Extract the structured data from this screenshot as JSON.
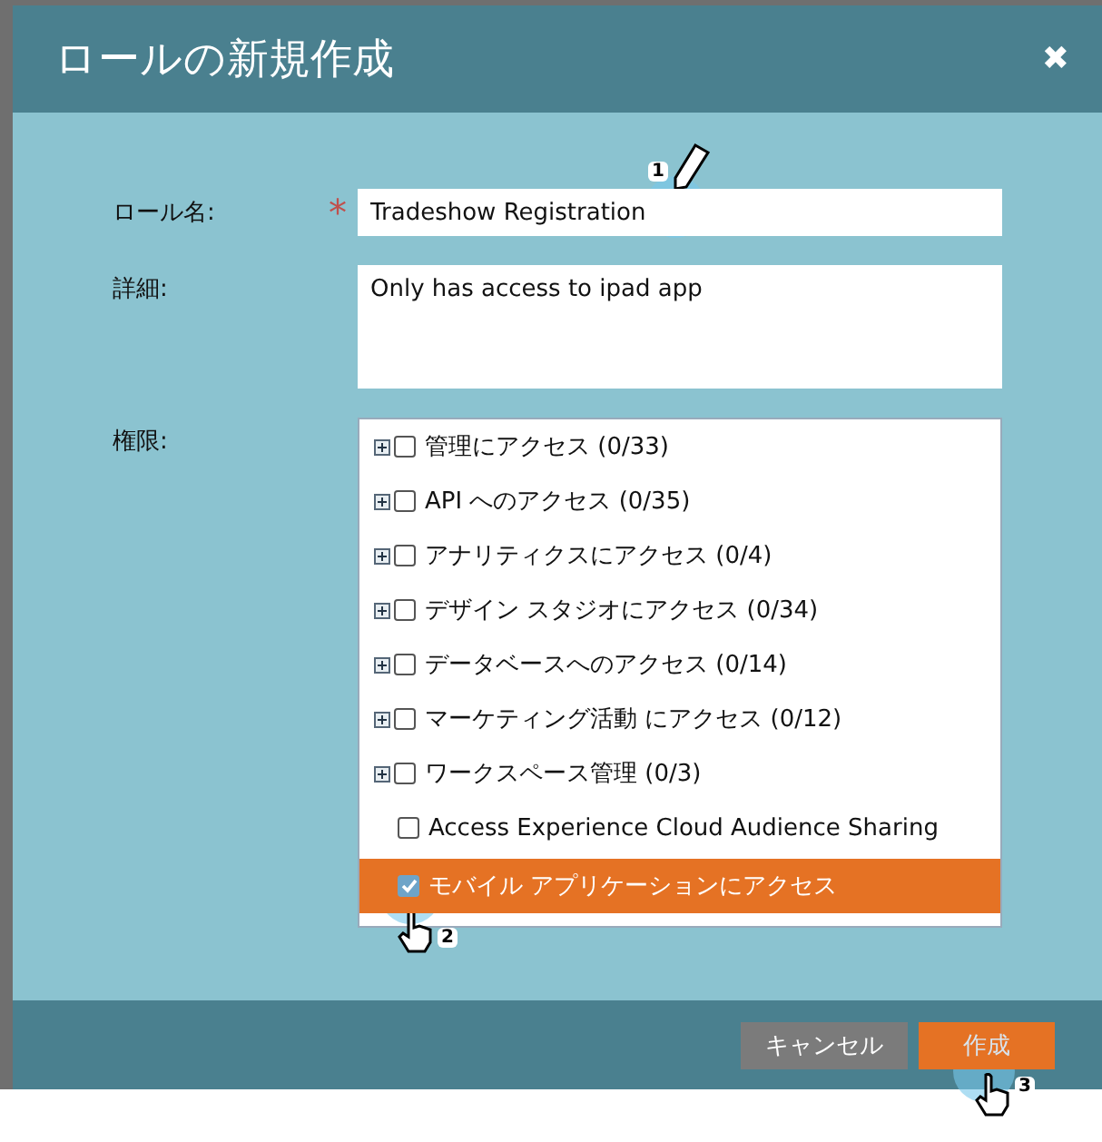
{
  "dialog": {
    "title": "ロールの新規作成",
    "close": "✖"
  },
  "form": {
    "name_label": "ロール名:",
    "required_mark": "*",
    "name_value": "Tradeshow Registration",
    "details_label": "詳細:",
    "details_value": "Only has access to ipad app",
    "permissions_label": "権限:"
  },
  "permissions": [
    {
      "kind": "group",
      "label": "管理にアクセス (0/33)",
      "checked": false,
      "selected": false
    },
    {
      "kind": "group",
      "label": "API へのアクセス (0/35)",
      "checked": false,
      "selected": false
    },
    {
      "kind": "group",
      "label": "アナリティクスにアクセス (0/4)",
      "checked": false,
      "selected": false
    },
    {
      "kind": "group",
      "label": "デザイン スタジオにアクセス (0/34)",
      "checked": false,
      "selected": false
    },
    {
      "kind": "group",
      "label": "データベースへのアクセス (0/14)",
      "checked": false,
      "selected": false
    },
    {
      "kind": "group",
      "label": "マーケティング活動 にアクセス (0/12)",
      "checked": false,
      "selected": false
    },
    {
      "kind": "group",
      "label": "ワークスペース管理 (0/3)",
      "checked": false,
      "selected": false
    },
    {
      "kind": "leaf",
      "label": "Access Experience Cloud Audience Sharing",
      "checked": false,
      "selected": false
    },
    {
      "kind": "leaf",
      "label": "モバイル アプリケーションにアクセス",
      "checked": true,
      "selected": true
    }
  ],
  "buttons": [
    {
      "kind": "secondary",
      "label": "キャンセル"
    },
    {
      "kind": "primary",
      "label": "作成"
    }
  ],
  "step_markers": [
    {
      "kind": "pencil",
      "number": "1"
    },
    {
      "kind": "hand",
      "number": "2"
    },
    {
      "kind": "hand",
      "number": "3"
    }
  ]
}
